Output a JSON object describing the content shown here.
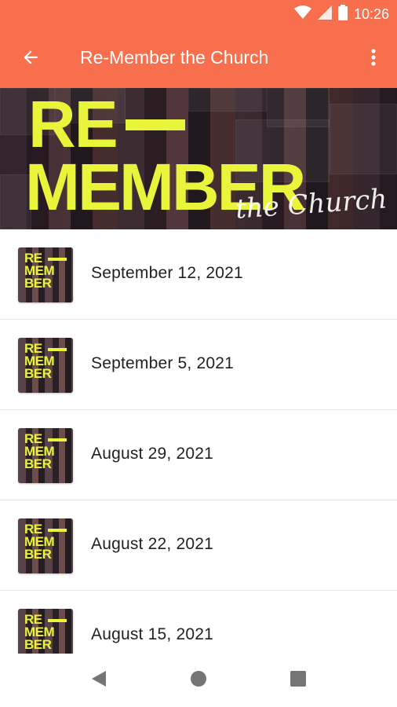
{
  "status": {
    "time": "10:26",
    "icons": [
      "wifi-icon",
      "signal-icon",
      "battery-icon"
    ]
  },
  "appbar": {
    "title": "Re-Member the Church",
    "back_icon": "arrow-back-icon",
    "more_icon": "more-vert-icon"
  },
  "hero": {
    "line1": "RE",
    "line2": "MEMBER",
    "script": "the Church"
  },
  "thumbnail": {
    "line1": "RE",
    "line2": "MEM",
    "line3": "BER"
  },
  "items": [
    {
      "label": "September 12, 2021"
    },
    {
      "label": "September 5, 2021"
    },
    {
      "label": "August 29, 2021"
    },
    {
      "label": "August 22, 2021"
    },
    {
      "label": "August 15, 2021"
    }
  ],
  "colors": {
    "accent": "#f76f4d",
    "brand_yellow": "#e8f53a",
    "text": "#222222"
  },
  "navbar": {
    "icons": [
      "back-triangle-icon",
      "home-circle-icon",
      "recents-square-icon"
    ]
  }
}
